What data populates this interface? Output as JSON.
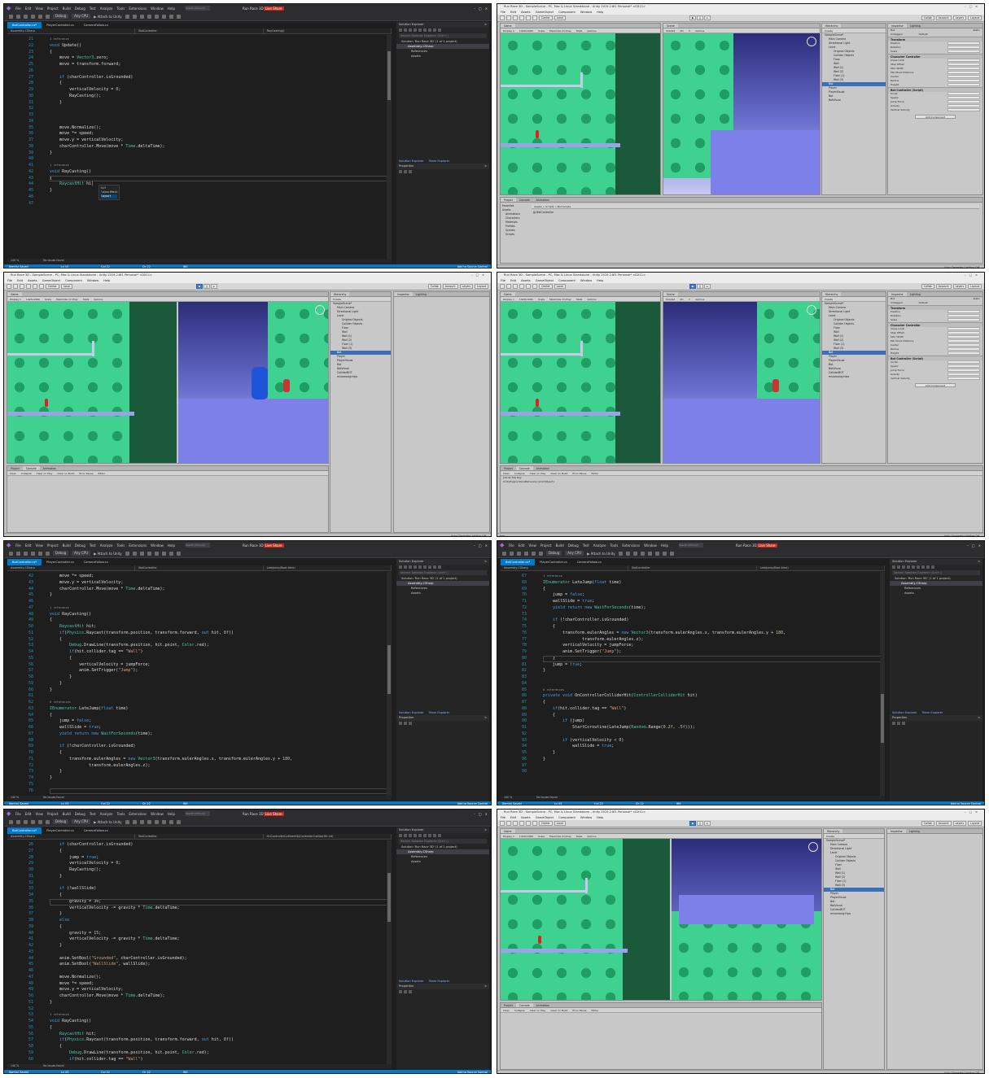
{
  "vs": {
    "app_title": "Run Race 3D",
    "menu": [
      "File",
      "Edit",
      "View",
      "Project",
      "Build",
      "Debug",
      "Test",
      "Analyze",
      "Tools",
      "Extensions",
      "Window",
      "Help"
    ],
    "search_placeholder": "Search (Ctrl+Q)",
    "live_share": "Live Share",
    "toolbar": {
      "config": "Debug",
      "platform": "Any CPU",
      "attach": "Attach to Unity"
    },
    "tabs": [
      "BotController.cs*",
      "PlayerController.cs",
      "CameraFollow.cs"
    ],
    "navbar": [
      "Assembly-CSharp",
      "BotController",
      "RayCasting()"
    ],
    "solution_explorer": {
      "title": "Solution Explorer",
      "search": "Search Solution Explorer (Ctrl+;)",
      "solution": "Solution 'Run Race 3D' (1 of 1 project)",
      "project": "Assembly-CSharp",
      "references": "References",
      "assets": "Assets",
      "tabs": [
        "Solution Explorer",
        "Team Explorer"
      ],
      "properties": "Properties"
    },
    "status": {
      "ready": "Item(s) Saved",
      "ln": "Ln 43",
      "col": "Col 22",
      "ch": "Ch 22",
      "ins": "INS",
      "right": "Add to Source Control"
    },
    "zoom": "140 %",
    "no_issues": "No issues found"
  },
  "editors": [
    {
      "first_line": 21,
      "current_line": 43,
      "nav_method": "RayCasting()",
      "lines": [
        "1 reference",
        "void Update()",
        "{",
        "    move = Vector3.zero;",
        "    move = transform.forward;",
        "",
        "    if (charController.isGrounded)",
        "    {",
        "        verticalVelocity = 0;",
        "        RayCasting();",
        "    }",
        "",
        "",
        "",
        "    move.Normalize();",
        "    move *= speed;",
        "    move.y = verticalVelocity;",
        "    charController.Move(move * Time.deltaTime);",
        "}",
        "",
        "1 reference",
        "void RayCasting()",
        "{",
        "    RaycastHit hi|",
        "}",
        "",
        ""
      ],
      "intellisense": [
        "hit",
        "layoutMask",
        "layout"
      ]
    },
    {
      "first_line": 42,
      "current_line": 76,
      "nav_method": "LateJump(float time)",
      "lines": [
        "    move *= speed;",
        "    move.y = verticalVelocity;",
        "    charController.Move(move * Time.deltaTime);",
        "}",
        "",
        "1 reference",
        "void RayCasting()",
        "{",
        "    RaycastHit hit;",
        "    if(Physics.Raycast(transform.position, transform.forward, out hit, 8f))",
        "    {",
        "        Debug.DrawLine(transform.position, hit.point, Color.red);",
        "        if(hit.collider.tag == \"Wall\")",
        "        {",
        "            verticalVelocity = jumpForce;",
        "            anim.SetTrigger(\"Jump\");",
        "        }",
        "    }",
        "}",
        "",
        "0 references",
        "IEnumerator LateJump(float time)",
        "{",
        "    jump = false;",
        "    wallSlide = true;",
        "    yield return new WaitForSeconds(time);",
        "",
        "    if (!charController.isGrounded)",
        "    {",
        "        transform.eulerAngles = new Vector3(transform.eulerAngles.x, transform.eulerAngles.y + 180,",
        "                transform.eulerAngles.z);",
        "    }",
        "}",
        "",
        ""
      ]
    },
    {
      "first_line": 67,
      "current_line": 80,
      "nav_method": "LateJump(float time)",
      "lines": [
        "1 reference",
        "IEnumerator LateJump(float time)",
        "{",
        "    jump = false;",
        "    wallSlide = true;",
        "    yield return new WaitForSeconds(time);",
        "",
        "    if (!charController.isGrounded)",
        "    {",
        "        transform.eulerAngles = new Vector3(transform.eulerAngles.x, transform.eulerAngles.y + 180,",
        "                transform.eulerAngles.z);",
        "        verticalVelocity = jumpForce;",
        "        anim.SetTrigger(\"Jump\");",
        "    }",
        "    jump = true;",
        "}",
        "",
        "",
        "0 references",
        "private void OnControllerColliderHit(ControllerColliderHit hit)",
        "{",
        "    if(hit.collider.tag == \"Wall\")",
        "    {",
        "        if (jump)",
        "            StartCoroutine(LateJump(Random.Range(0.2f, .5f)));",
        "",
        "        if (verticalVelocity < 0)",
        "            wallSlide = true;",
        "    }",
        "}",
        "",
        ""
      ]
    },
    {
      "first_line": 26,
      "current_line": 35,
      "nav_method": "OnControllerColliderHit(ControllerColliderHit hit)",
      "lines": [
        "    if (charController.isGrounded)",
        "    {",
        "        jump = true;",
        "        verticalVelocity = 0;",
        "        RayCasting();",
        "    }",
        "",
        "    if (!wallSlide)",
        "    {",
        "        gravity = 30;",
        "        verticalVelocity -= gravity * Time.deltaTime;",
        "    }",
        "    else",
        "    {",
        "        gravity = 15;",
        "        verticalVelocity -= gravity * Time.deltaTime;",
        "    }",
        "",
        "    anim.SetBool(\"Grounded\", charController.isGrounded);",
        "    anim.SetBool(\"WallSlide\", wallSlide);",
        "",
        "    move.Normalize();",
        "    move *= speed;",
        "    move.y = verticalVelocity;",
        "    charController.Move(move * Time.deltaTime);",
        "}",
        "",
        "1 reference",
        "void RayCasting()",
        "{",
        "    RaycastHit hit;",
        "    if(Physics.Raycast(transform.position, transform.forward, out hit, 8f))",
        "    {",
        "        Debug.DrawLine(transform.position, hit.point, Color.red);",
        "        if(hit.collider.tag == \"Wall\")"
      ]
    }
  ],
  "unity": {
    "title": "Run Race 3D - SampleScene - PC, Mac & Linux Standalone - Unity 2019.2.8f1 Personal* <DX11>",
    "menu": [
      "File",
      "Edit",
      "Assets",
      "GameObject",
      "Component",
      "Window",
      "Help"
    ],
    "tools": {
      "center": "Center",
      "local": "Local",
      "collab": "Collab",
      "account": "Account",
      "layers": "Layers",
      "layout": "Layout"
    },
    "game_tab": "Game",
    "scene_tab": "Scene",
    "display": "Display 1",
    "aspect": "1920x1080",
    "scale": "Scale",
    "maximize": "Maximize On Play",
    "stats": "Stats",
    "gizmos": "Gizmos",
    "shaded": "Shaded",
    "hierarchy": {
      "title": "Hierarchy",
      "create": "Create",
      "items": [
        "SampleScene*",
        "Main Camera",
        "Directional Light",
        "Level",
        "Original Objects",
        "Collider Objects",
        "Floor",
        "Wall",
        "Wall (1)",
        "Wall (2)",
        "Floor (1)",
        "Wall (3)",
        "Bot",
        "Player",
        "PlayerVisual",
        "Bot",
        "BotVisual",
        "ColliderBOT",
        "mixamorig:Hips"
      ]
    },
    "inspector": {
      "title": "Inspector",
      "lighting": "Lighting",
      "object": "Bot",
      "tag": "Untagged",
      "layer": "Default",
      "static": "Static",
      "transform": "Transform",
      "position": "Position",
      "rotation": "Rotation",
      "scale": "Scale",
      "char_ctrl": "Character Controller",
      "cc_fields": [
        "Slope Limit",
        "Step Offset",
        "Skin Width",
        "Min Move Distance",
        "Center",
        "Radius",
        "Height"
      ],
      "bot_ctrl": "Bot Controller (Script)",
      "bc_fields": [
        "Script",
        "Speed",
        "Jump Force",
        "Gravity",
        "Vertical Velocity"
      ],
      "add_component": "Add Component"
    },
    "project": {
      "tabs": [
        "Project",
        "Console",
        "Animation"
      ],
      "favorites": "Favorites",
      "assets": "Assets",
      "folders": [
        "Animations",
        "Characters",
        "Materials",
        "Prefabs",
        "Scenes",
        "Scripts"
      ],
      "path": "Assets > Scripts > Bot Scripts",
      "file": "BotController"
    },
    "console": {
      "tabs": [
        "Project",
        "Console",
        "Animation"
      ],
      "buttons": [
        "Clear",
        "Collapse",
        "Clear on Play",
        "Clear on Build",
        "Error Pause",
        "Editor"
      ],
      "log": "[10:41:59] Hey",
      "log2": "UnityEngine.MonoBehaviour:print(Object)"
    },
    "status_right": "Auto Generate Lighting Off",
    "status_left": "Hey",
    "status_bake": "Bake paused in play mode"
  }
}
